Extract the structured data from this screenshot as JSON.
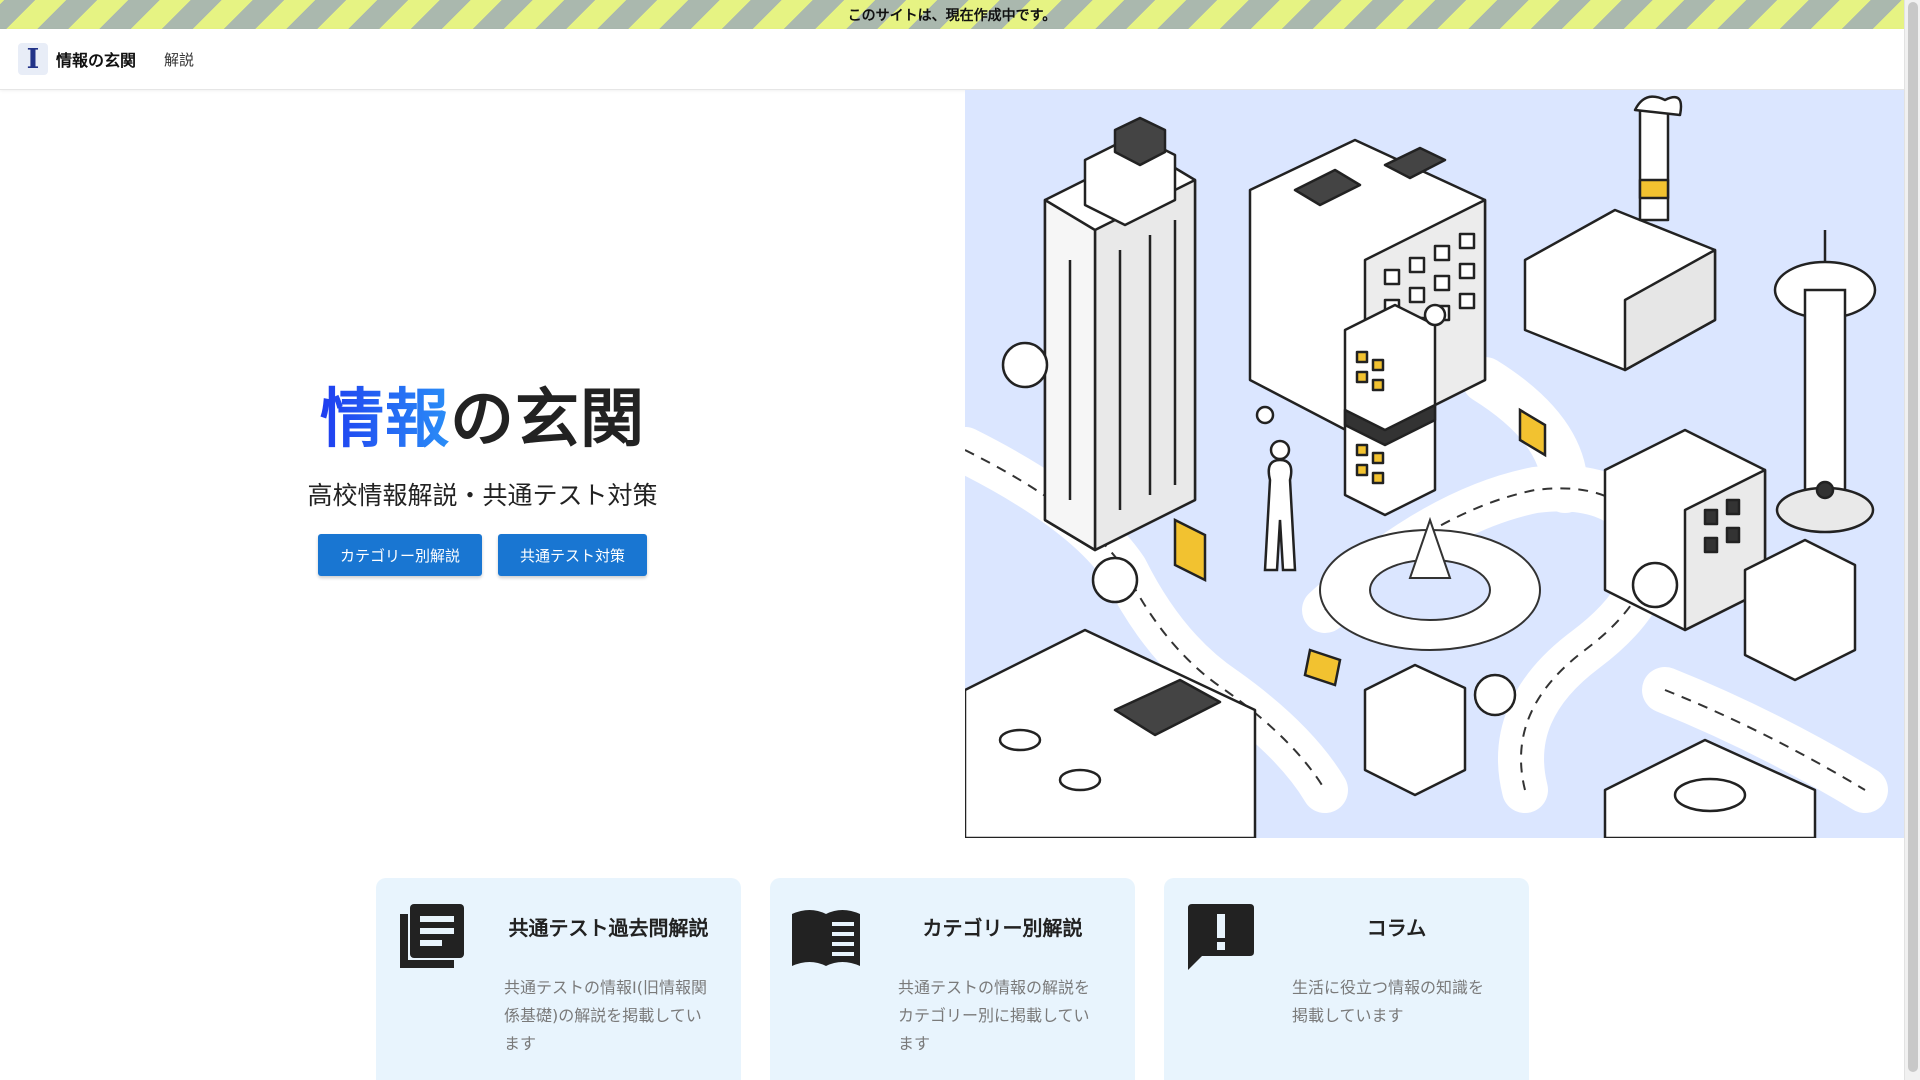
{
  "notice": {
    "text": "このサイトは、現在作成中です。"
  },
  "header": {
    "logo_letter": "I",
    "brand": "情報の玄関",
    "nav": [
      {
        "label": "解説"
      }
    ]
  },
  "hero": {
    "title_accent": "情報",
    "title_rest": "の玄関",
    "subtitle": "高校情報解説・共通テスト対策",
    "buttons": [
      {
        "label": "カテゴリー別解説"
      },
      {
        "label": "共通テスト対策"
      }
    ]
  },
  "cards": [
    {
      "icon": "article-icon",
      "title": "共通テスト過去問解説",
      "desc": "共通テストの情報I(旧情報関係基礎)の解説を掲載しています"
    },
    {
      "icon": "open-book-icon",
      "title": "カテゴリー別解説",
      "desc": "共通テストの情報の解説をカテゴリー別に掲載しています"
    },
    {
      "icon": "announcement-icon",
      "title": "コラム",
      "desc": "生活に役立つ情報の知識を掲載しています"
    }
  ],
  "colors": {
    "primary": "#1976d2",
    "card_bg": "#e8f4fd",
    "illust_bg": "#dbe6ff",
    "accent_gradient_start": "#1f3df0",
    "accent_gradient_end": "#2a8ef7"
  }
}
